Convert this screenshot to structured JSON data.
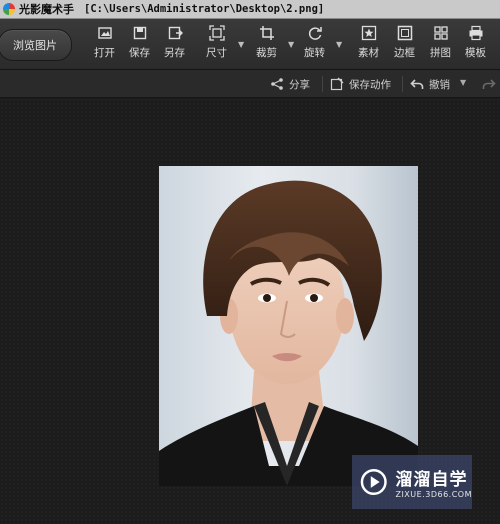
{
  "window": {
    "app_title": "光影魔术手",
    "file_path": "[C:\\Users\\Administrator\\Desktop\\2.png]"
  },
  "toolbar": {
    "browse_label": "浏览图片",
    "tools": [
      {
        "label": "打开",
        "icon": "open-image-icon"
      },
      {
        "label": "保存",
        "icon": "save-icon"
      },
      {
        "label": "另存",
        "icon": "save-as-icon"
      },
      {
        "label": "尺寸",
        "icon": "resize-icon",
        "dropdown": true
      },
      {
        "label": "裁剪",
        "icon": "crop-icon",
        "dropdown": true
      },
      {
        "label": "旋转",
        "icon": "rotate-icon",
        "dropdown": true
      },
      {
        "label": "素材",
        "icon": "material-star-icon"
      },
      {
        "label": "边框",
        "icon": "frame-icon"
      },
      {
        "label": "拼图",
        "icon": "collage-icon"
      },
      {
        "label": "模板",
        "icon": "template-printer-icon"
      }
    ]
  },
  "subbar": {
    "share_label": "分享",
    "save_action_label": "保存动作",
    "undo_label": "撤销"
  },
  "watermark": {
    "name": "溜溜自学",
    "url": "ZIXUE.3D66.COM"
  }
}
